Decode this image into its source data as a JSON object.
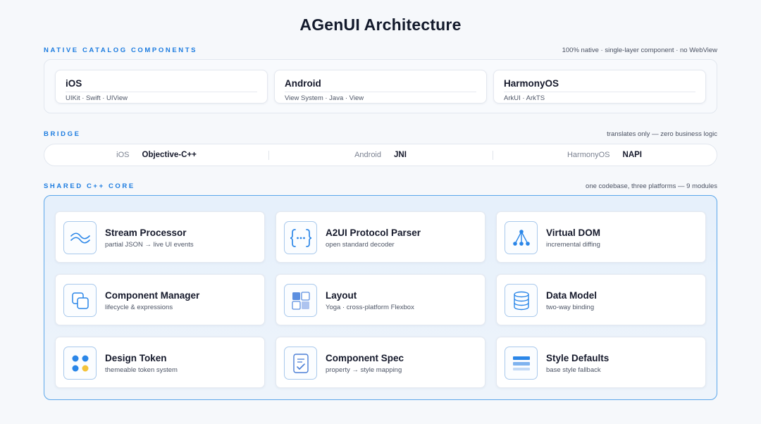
{
  "title": "AGenUI Architecture",
  "native": {
    "label": "NATIVE CATALOG COMPONENTS",
    "note": "100% native · single-layer component · no WebView",
    "platforms": [
      {
        "name": "iOS",
        "stack": "UIKit · Swift · UIView"
      },
      {
        "name": "Android",
        "stack": "View System · Java · View"
      },
      {
        "name": "HarmonyOS",
        "stack": "ArkUI · ArkTS"
      }
    ]
  },
  "bridge": {
    "label": "BRIDGE",
    "note": "translates only — zero business logic",
    "items": [
      {
        "platform": "iOS",
        "tech": "Objective-C++"
      },
      {
        "platform": "Android",
        "tech": "JNI"
      },
      {
        "platform": "HarmonyOS",
        "tech": "NAPI"
      }
    ]
  },
  "core": {
    "label": "SHARED C++ CORE",
    "note": "one codebase, three platforms — 9 modules",
    "modules": [
      {
        "title": "Stream Processor",
        "desc": "partial JSON → live UI events",
        "icon": "wave-icon"
      },
      {
        "title": "A2UI Protocol Parser",
        "desc": "open standard decoder",
        "icon": "braces-icon"
      },
      {
        "title": "Virtual DOM",
        "desc": "incremental diffing",
        "icon": "tree-icon"
      },
      {
        "title": "Component Manager",
        "desc": "lifecycle & expressions",
        "icon": "stacked-squares-icon"
      },
      {
        "title": "Layout",
        "desc": "Yoga · cross-platform Flexbox",
        "icon": "grid-icon"
      },
      {
        "title": "Data Model",
        "desc": "two-way binding",
        "icon": "database-icon"
      },
      {
        "title": "Design Token",
        "desc": "themeable token system",
        "icon": "color-dots-icon"
      },
      {
        "title": "Component Spec",
        "desc": "property → style mapping",
        "icon": "spec-document-icon"
      },
      {
        "title": "Style Defaults",
        "desc": "base style fallback",
        "icon": "layers-icon"
      }
    ]
  },
  "colors": {
    "accent": "#1c7ce0",
    "core_border": "#5aa6ea",
    "icon_blue": "#2a86e8",
    "token_yellow": "#f4c33a"
  }
}
